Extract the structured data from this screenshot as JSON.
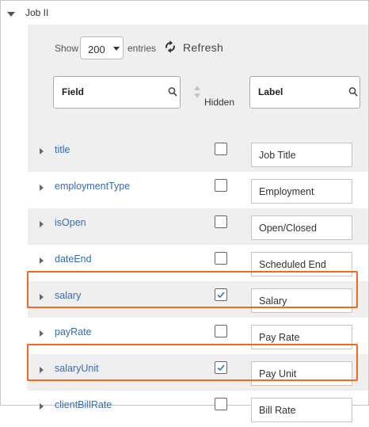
{
  "section": {
    "title": "Job II"
  },
  "toolbar": {
    "show_label": "Show",
    "entries_value": "200",
    "entries_label": "entries",
    "refresh_label": "Refresh"
  },
  "columns": {
    "field": "Field",
    "hidden": "Hidden",
    "label": "Label"
  },
  "rows": [
    {
      "field": "title",
      "hidden": false,
      "label": "Job Title",
      "highlighted": false
    },
    {
      "field": "employmentType",
      "hidden": false,
      "label": "Employment",
      "highlighted": false
    },
    {
      "field": "isOpen",
      "hidden": false,
      "label": "Open/Closed",
      "highlighted": false
    },
    {
      "field": "dateEnd",
      "hidden": false,
      "label": "Scheduled End",
      "highlighted": false
    },
    {
      "field": "salary",
      "hidden": true,
      "label": "Salary",
      "highlighted": true
    },
    {
      "field": "payRate",
      "hidden": false,
      "label": "Pay Rate",
      "highlighted": false
    },
    {
      "field": "salaryUnit",
      "hidden": true,
      "label": "Pay Unit",
      "highlighted": true
    },
    {
      "field": "clientBillRate",
      "hidden": false,
      "label": "Bill Rate",
      "highlighted": false
    }
  ],
  "colors": {
    "link": "#3a6ab4",
    "highlight": "#f06a22",
    "check": "#4a7fc0",
    "band": "#efefef"
  }
}
